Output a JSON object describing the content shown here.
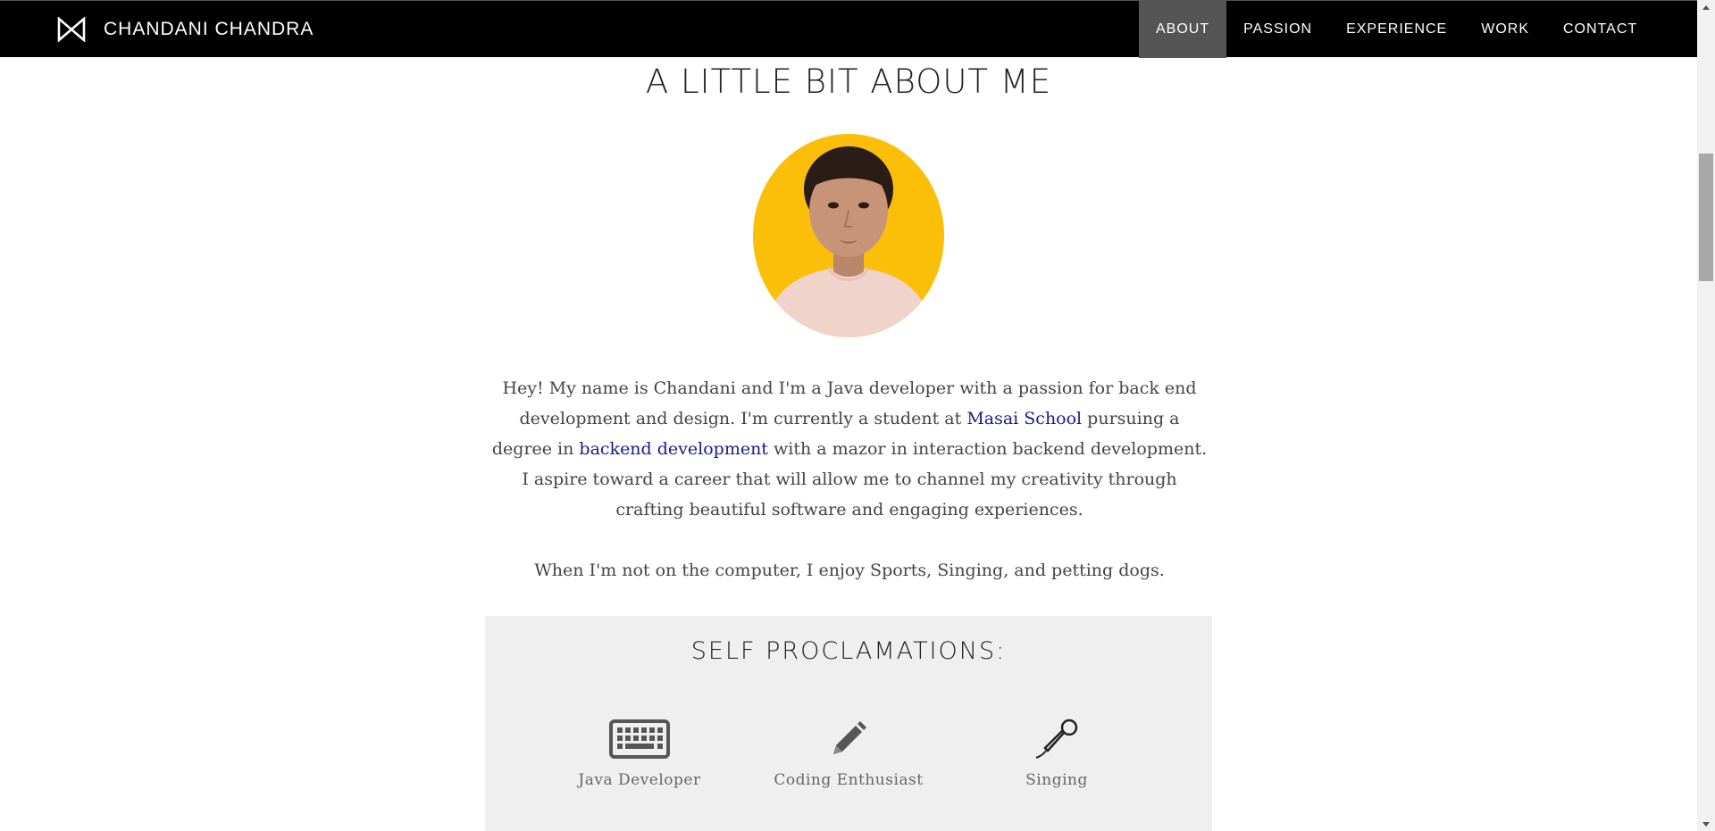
{
  "header": {
    "brand_name": "CHANDANI CHANDRA",
    "logo_icon": "bowtie-logo-icon",
    "nav": [
      {
        "label": "ABOUT",
        "active": true
      },
      {
        "label": "PASSION",
        "active": false
      },
      {
        "label": "EXPERIENCE",
        "active": false
      },
      {
        "label": "WORK",
        "active": false
      },
      {
        "label": "CONTACT",
        "active": false
      }
    ]
  },
  "about": {
    "title": "A LITTLE BIT ABOUT ME",
    "avatar_alt": "profile photo",
    "bio": {
      "part1": "Hey! My name is Chandani and I'm a Java developer with a passion for back end development and design. I'm currently a student at ",
      "link1": "Masai School",
      "part2": " pursuing a degree in ",
      "link2": "backend development",
      "part3": " with a mazor in interaction backend development. I aspire toward a career that will allow me to channel my creativity through crafting beautiful software and engaging experiences."
    },
    "hobbies": "When I'm not on the computer, I enjoy Sports, Singing, and petting dogs."
  },
  "proclamations": {
    "title": "SELF PROCLAMATIONS:",
    "items": [
      {
        "label": "Java Developer",
        "icon": "keyboard-icon"
      },
      {
        "label": "Coding Enthusiast",
        "icon": "pencil-icon"
      },
      {
        "label": "Singing",
        "icon": "microphone-icon"
      }
    ]
  },
  "colors": {
    "navbar_bg": "#000000",
    "nav_active_bg": "#555555",
    "avatar_bg": "#fbbf0a",
    "link": "#1a1a8c",
    "panel_bg": "#efefef"
  }
}
